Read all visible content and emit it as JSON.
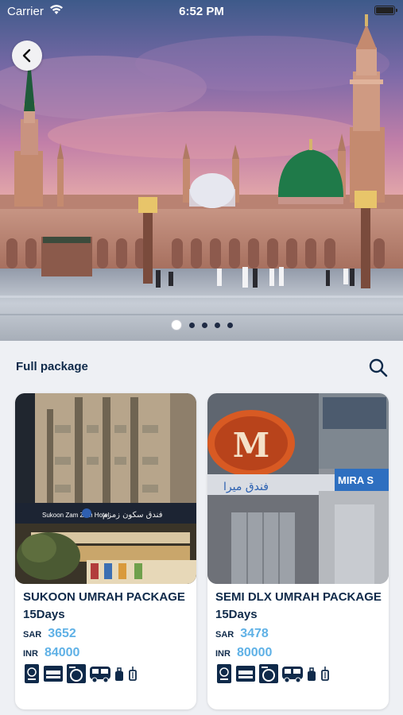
{
  "status": {
    "carrier": "Carrier",
    "time": "6:52 PM"
  },
  "hero": {
    "slides": 5,
    "active_slide": 1
  },
  "section": {
    "title": "Full package"
  },
  "packages": [
    {
      "title": "SUKOON UMRAH PACKAGE 15Days",
      "image_text": "Sukoon Zam Zam Hotel",
      "prices": [
        {
          "currency": "SAR",
          "amount": "3652"
        },
        {
          "currency": "INR",
          "amount": "84000"
        }
      ],
      "amenities": [
        "passport-icon",
        "bed-icon",
        "washing-machine-icon",
        "bus-icon",
        "luggage-icon",
        "trolley-icon"
      ]
    },
    {
      "title": "SEMI DLX UMRAH PACKAGE 15Days",
      "image_logo": "M",
      "image_text": "MIRA S",
      "prices": [
        {
          "currency": "SAR",
          "amount": "3478"
        },
        {
          "currency": "INR",
          "amount": "80000"
        }
      ],
      "amenities": [
        "passport-icon",
        "bed-icon",
        "washing-machine-icon",
        "bus-icon",
        "luggage-icon",
        "trolley-icon"
      ]
    }
  ],
  "colors": {
    "primary": "#0f2a4a",
    "price": "#5fb1e6",
    "background": "#eef0f4"
  }
}
